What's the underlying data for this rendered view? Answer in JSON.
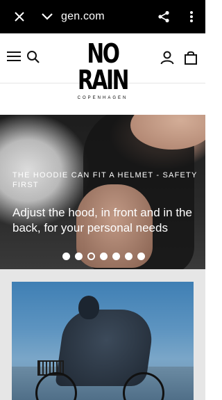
{
  "browser": {
    "url_text": "gen.com",
    "icons": [
      "close-icon",
      "chevron-down-icon",
      "share-icon",
      "more-vertical-icon"
    ]
  },
  "header": {
    "logo_main": "NO RAIN",
    "logo_sub": "COPENHAGEN",
    "icons": [
      "menu-icon",
      "search-icon",
      "account-icon",
      "bag-icon"
    ]
  },
  "hero": {
    "kicker": "THE HOODIE CAN FIT A HELMET - SAFETY FIRST",
    "title": "Adjust the hood, in front and in the back, for your personal needs",
    "slide_count": 7,
    "active_slide": 3
  }
}
